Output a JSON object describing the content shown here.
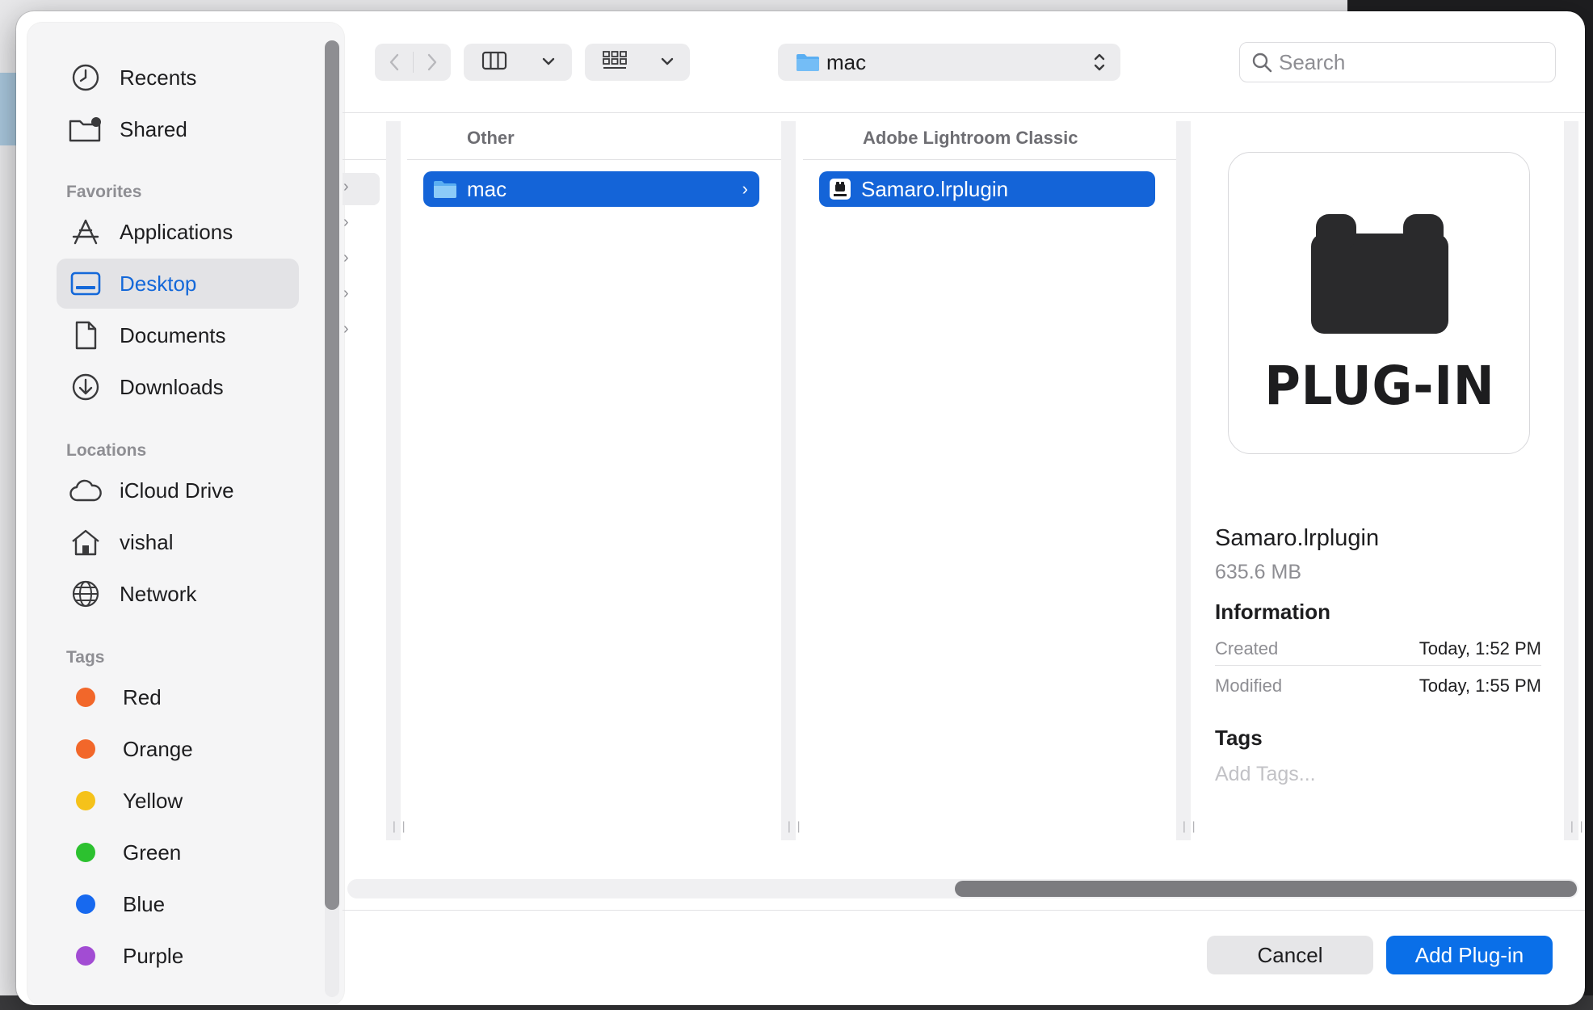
{
  "sidebar": {
    "top_items": [
      {
        "label": "Recents",
        "icon": "clock-icon"
      },
      {
        "label": "Shared",
        "icon": "shared-folder-icon"
      }
    ],
    "favorites_header": "Favorites",
    "favorites": [
      {
        "label": "Applications",
        "icon": "applications-icon"
      },
      {
        "label": "Desktop",
        "icon": "desktop-icon",
        "selected": true
      },
      {
        "label": "Documents",
        "icon": "document-icon"
      },
      {
        "label": "Downloads",
        "icon": "download-icon"
      }
    ],
    "locations_header": "Locations",
    "locations": [
      {
        "label": "iCloud Drive",
        "icon": "cloud-icon"
      },
      {
        "label": "vishal",
        "icon": "home-icon"
      },
      {
        "label": "Network",
        "icon": "globe-icon"
      }
    ],
    "tags_header": "Tags",
    "tags": [
      {
        "label": "Red",
        "color": "#f2672a"
      },
      {
        "label": "Orange",
        "color": "#f2672a"
      },
      {
        "label": "Yellow",
        "color": "#f5c21a"
      },
      {
        "label": "Green",
        "color": "#2cc12f"
      },
      {
        "label": "Blue",
        "color": "#1769ef"
      },
      {
        "label": "Purple",
        "color": "#a24cd3"
      }
    ]
  },
  "toolbar": {
    "path_popup_value": "mac",
    "search_placeholder": "Search"
  },
  "browser": {
    "columns": [
      {
        "header": "Other",
        "selected_item": "mac",
        "item_icon": "folder-icon"
      },
      {
        "header": "Adobe Lightroom Classic",
        "selected_item": "Samaro.lrplugin",
        "item_icon": "plugin-file-icon"
      }
    ]
  },
  "preview": {
    "icon_label": "PLUG-IN",
    "file_name": "Samaro.lrplugin",
    "file_size": "635.6 MB",
    "information_header": "Information",
    "info": [
      {
        "key": "Created",
        "value": "Today, 1:52 PM"
      },
      {
        "key": "Modified",
        "value": "Today, 1:55 PM"
      }
    ],
    "tags_header": "Tags",
    "tags_placeholder": "Add Tags..."
  },
  "buttons": {
    "cancel": "Cancel",
    "primary": "Add Plug-in"
  },
  "colors": {
    "accent": "#1464d8",
    "primary_button": "#0a6fe8",
    "sidebar_selected_text": "#1468d9"
  }
}
